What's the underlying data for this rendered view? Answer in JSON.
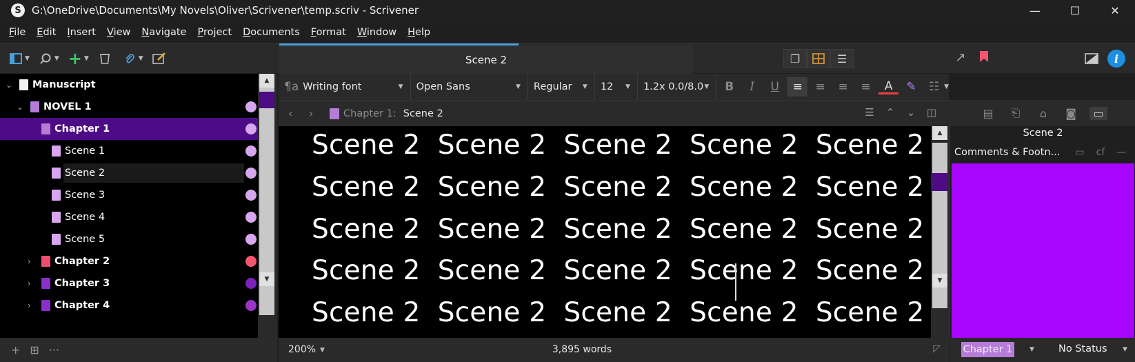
{
  "window": {
    "title": "G:\\OneDrive\\Documents\\My Novels\\Oliver\\Scrivener\\temp.scriv - Scrivener",
    "logo": "S",
    "controls": [
      "—",
      "☐",
      "✕"
    ]
  },
  "menu": [
    "File",
    "Edit",
    "Insert",
    "View",
    "Navigate",
    "Project",
    "Documents",
    "Format",
    "Window",
    "Help"
  ],
  "toolbar": {
    "doc_tab": "Scene 2"
  },
  "binder": {
    "rows": [
      {
        "label": "Manuscript",
        "bold": true,
        "level": 0,
        "icon_color": "#f2f2f2"
      },
      {
        "label": "NOVEL 1",
        "bold": true,
        "level": 1,
        "icon_color": "#b47cd6",
        "dot": "#d7a6ee"
      },
      {
        "label": "Chapter 1",
        "bold": true,
        "level": 2,
        "icon_color": "#b47cd6",
        "dot": "#d7a6ee",
        "selected": true
      },
      {
        "label": "Scene 1",
        "bold": false,
        "level": 3,
        "icon_color": "#d7a6ee",
        "dot": "#d7a6ee"
      },
      {
        "label": "Scene 2",
        "bold": false,
        "level": 3,
        "icon_color": "#d7a6ee",
        "dot": "#d7a6ee",
        "current": true
      },
      {
        "label": "Scene 3",
        "bold": false,
        "level": 3,
        "icon_color": "#d7a6ee",
        "dot": "#d7a6ee"
      },
      {
        "label": "Scene 4",
        "bold": false,
        "level": 3,
        "icon_color": "#d7a6ee",
        "dot": "#d7a6ee"
      },
      {
        "label": "Scene 5",
        "bold": false,
        "level": 3,
        "icon_color": "#d7a6ee",
        "dot": "#d7a6ee"
      },
      {
        "label": "Chapter 2",
        "bold": true,
        "level": 2,
        "icon_color": "#ec4d6d",
        "dot": "#f5566f"
      },
      {
        "label": "Chapter 3",
        "bold": true,
        "level": 2,
        "icon_color": "#8a2fc8",
        "dot": "#7a22bb"
      },
      {
        "label": "Chapter 4",
        "bold": true,
        "level": 2,
        "icon_color": "#8a2fc8",
        "dot": "#9a35c8"
      }
    ]
  },
  "format": {
    "style": "Writing font",
    "font": "Open Sans",
    "weight": "Regular",
    "size": "12",
    "spacing": "1.2x 0.0/8.0"
  },
  "header": {
    "parent": "Chapter 1:",
    "current": "Scene 2"
  },
  "editor": {
    "lines": [
      "Scene 2  Scene 2  Scene 2  Scene 2  Scene 2",
      "Scene 2  Scene 2  Scene 2  Scene 2  Scene 2",
      "Scene 2  Scene 2  Scene 2  Scene 2  Scene 2",
      "Scene 2  Scene 2  Scene 2  Scene 2  Scene 2",
      "Scene 2  Scene 2  Scene 2  Scene 2  Scene 2"
    ]
  },
  "footer": {
    "zoom": "200%",
    "word_count": "3,895 words"
  },
  "inspector": {
    "title": "Scene 2",
    "section": "Comments & Footn...",
    "section_tag": "cf",
    "label_value": "Chapter 1",
    "status_value": "No Status",
    "accent": "#a805ff"
  }
}
